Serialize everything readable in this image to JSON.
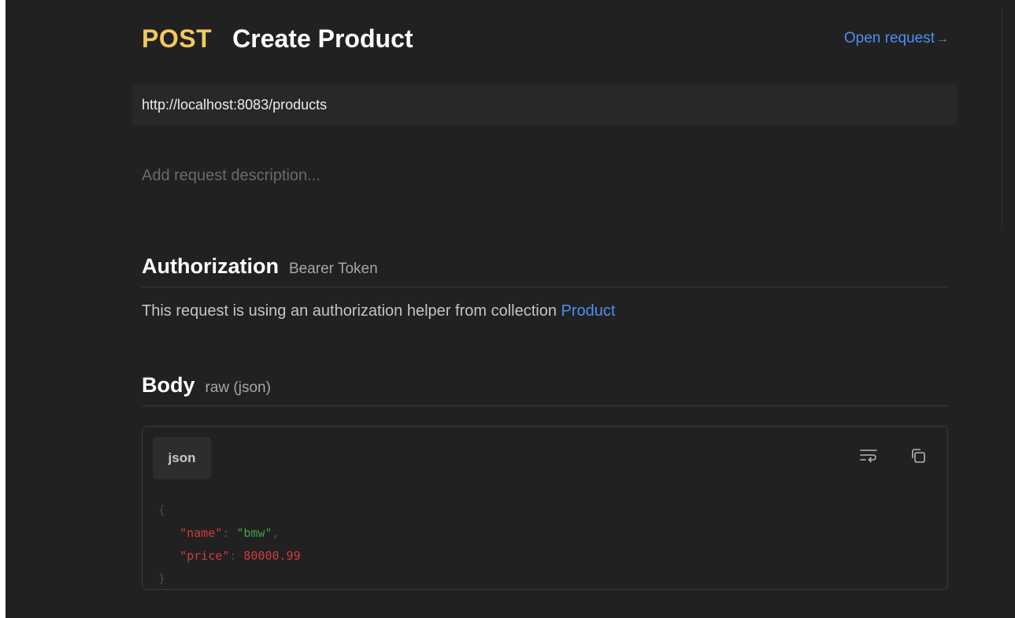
{
  "request": {
    "method": "POST",
    "name": "Create Product",
    "open_label": "Open request",
    "open_arrow": "→",
    "url": "http://localhost:8083/products",
    "description_placeholder": "Add request description..."
  },
  "authorization": {
    "heading": "Authorization",
    "type": "Bearer Token",
    "text": "This request is using an authorization helper from collection ",
    "collection_link": "Product"
  },
  "body": {
    "heading": "Body",
    "mode": "raw (json)",
    "language": "json",
    "code": {
      "open_brace": "{",
      "close_brace": "}",
      "line1_key": "\"name\"",
      "line1_colon": ": ",
      "line1_value": "\"bmw\"",
      "line1_comma": ",",
      "line2_key": "\"price\"",
      "line2_colon": ": ",
      "line2_value": "80000.99"
    }
  },
  "icons": {
    "wrap": "wrap-lines-icon",
    "copy": "copy-icon"
  },
  "colors": {
    "background": "#212121",
    "method": "#f4c95d",
    "link": "#4d8ff0",
    "json_key": "#d23a3a",
    "json_string": "#3fa33f"
  }
}
